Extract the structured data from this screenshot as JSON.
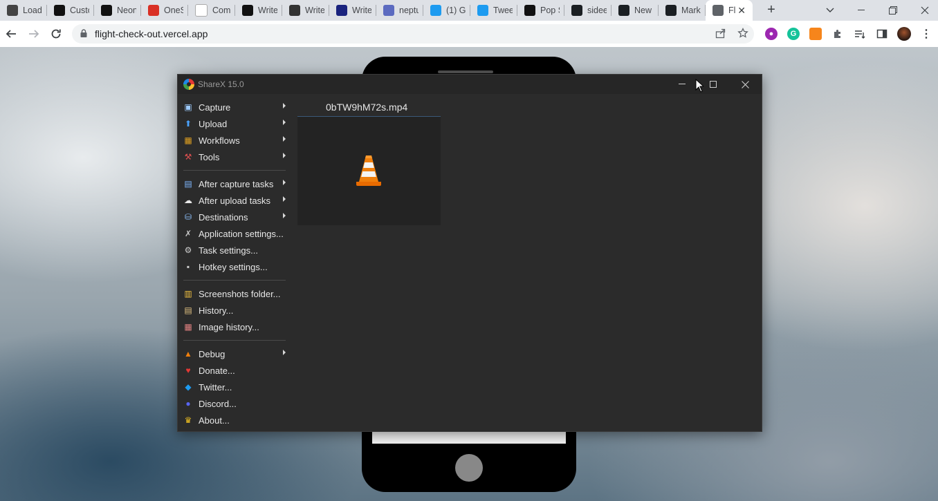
{
  "browser": {
    "tabs": [
      {
        "title": "Load",
        "icon": "loader-icon",
        "color": "#444444"
      },
      {
        "title": "Custo",
        "icon": "neon-icon",
        "color": "#111111"
      },
      {
        "title": "Neon",
        "icon": "neon-icon",
        "color": "#111111"
      },
      {
        "title": "OneS",
        "icon": "opera-icon",
        "color": "#d93025"
      },
      {
        "title": "Com",
        "icon": "notion-icon",
        "color": "#ffffff"
      },
      {
        "title": "Write",
        "icon": "circle-icon",
        "color": "#111111"
      },
      {
        "title": "Write",
        "icon": "openai-icon",
        "color": "#333333"
      },
      {
        "title": "Write",
        "icon": "bolt-icon",
        "color": "#1a237e"
      },
      {
        "title": "neptu",
        "icon": "neptune-icon",
        "color": "#5c6bc0"
      },
      {
        "title": "(1) G",
        "icon": "twitter-icon",
        "color": "#1d9bf0"
      },
      {
        "title": "Twee",
        "icon": "twitter-icon",
        "color": "#1d9bf0"
      },
      {
        "title": "Pop S",
        "icon": "pop-icon",
        "color": "#111111"
      },
      {
        "title": "sidee",
        "icon": "github-icon",
        "color": "#1b1f23"
      },
      {
        "title": "New",
        "icon": "github-icon",
        "color": "#1b1f23"
      },
      {
        "title": "Mark",
        "icon": "github-icon",
        "color": "#1b1f23"
      },
      {
        "title": "Fl",
        "icon": "globe-icon",
        "color": "#5f6368"
      }
    ],
    "url": "flight-check-out.vercel.app"
  },
  "sharex": {
    "title": "ShareX 15.0",
    "menu": [
      {
        "label": "Capture",
        "icon": "capture-icon",
        "submenu": true
      },
      {
        "label": "Upload",
        "icon": "upload-icon",
        "submenu": true
      },
      {
        "label": "Workflows",
        "icon": "workflows-icon",
        "submenu": true
      },
      {
        "label": "Tools",
        "icon": "tools-icon",
        "submenu": true
      },
      {
        "separator": true
      },
      {
        "label": "After capture tasks",
        "icon": "after-capture-icon",
        "submenu": true
      },
      {
        "label": "After upload tasks",
        "icon": "after-upload-icon",
        "submenu": true
      },
      {
        "label": "Destinations",
        "icon": "destinations-icon",
        "submenu": true
      },
      {
        "label": "Application settings...",
        "icon": "wrench-icon",
        "submenu": false
      },
      {
        "label": "Task settings...",
        "icon": "gear-icon",
        "submenu": false
      },
      {
        "label": "Hotkey settings...",
        "icon": "keyboard-icon",
        "submenu": false
      },
      {
        "separator": true
      },
      {
        "label": "Screenshots folder...",
        "icon": "folder-icon",
        "submenu": false
      },
      {
        "label": "History...",
        "icon": "history-icon",
        "submenu": false
      },
      {
        "label": "Image history...",
        "icon": "image-history-icon",
        "submenu": false
      },
      {
        "separator": true
      },
      {
        "label": "Debug",
        "icon": "debug-icon",
        "submenu": true
      },
      {
        "label": "Donate...",
        "icon": "heart-icon",
        "submenu": false
      },
      {
        "label": "Twitter...",
        "icon": "twitter-icon",
        "submenu": false
      },
      {
        "label": "Discord...",
        "icon": "discord-icon",
        "submenu": false
      },
      {
        "label": "About...",
        "icon": "crown-icon",
        "submenu": false
      }
    ],
    "file": {
      "name": "0bTW9hM72s.mp4",
      "thumbnail_icon": "vlc-cone-icon"
    }
  }
}
